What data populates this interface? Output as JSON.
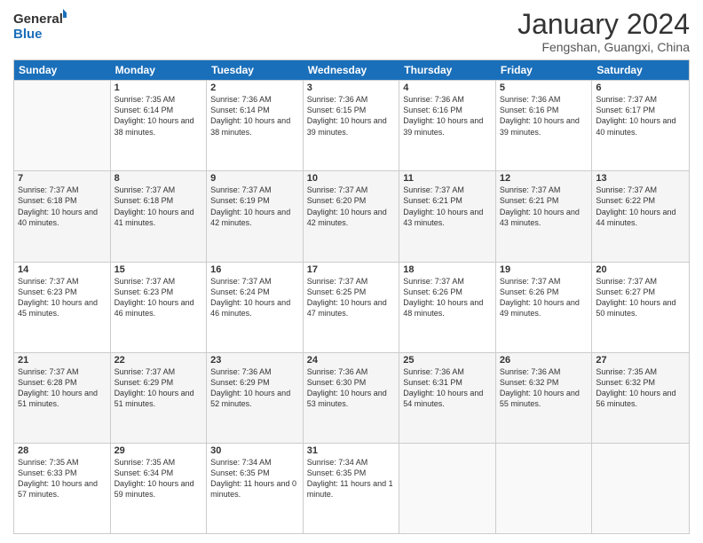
{
  "logo": {
    "line1": "General",
    "line2": "Blue"
  },
  "title": "January 2024",
  "location": "Fengshan, Guangxi, China",
  "weekdays": [
    "Sunday",
    "Monday",
    "Tuesday",
    "Wednesday",
    "Thursday",
    "Friday",
    "Saturday"
  ],
  "weeks": [
    [
      {
        "day": "",
        "empty": true
      },
      {
        "day": "1",
        "sunrise": "7:35 AM",
        "sunset": "6:14 PM",
        "daylight": "10 hours and 38 minutes."
      },
      {
        "day": "2",
        "sunrise": "7:36 AM",
        "sunset": "6:14 PM",
        "daylight": "10 hours and 38 minutes."
      },
      {
        "day": "3",
        "sunrise": "7:36 AM",
        "sunset": "6:15 PM",
        "daylight": "10 hours and 39 minutes."
      },
      {
        "day": "4",
        "sunrise": "7:36 AM",
        "sunset": "6:16 PM",
        "daylight": "10 hours and 39 minutes."
      },
      {
        "day": "5",
        "sunrise": "7:36 AM",
        "sunset": "6:16 PM",
        "daylight": "10 hours and 39 minutes."
      },
      {
        "day": "6",
        "sunrise": "7:37 AM",
        "sunset": "6:17 PM",
        "daylight": "10 hours and 40 minutes."
      }
    ],
    [
      {
        "day": "7",
        "sunrise": "7:37 AM",
        "sunset": "6:18 PM",
        "daylight": "10 hours and 40 minutes."
      },
      {
        "day": "8",
        "sunrise": "7:37 AM",
        "sunset": "6:18 PM",
        "daylight": "10 hours and 41 minutes."
      },
      {
        "day": "9",
        "sunrise": "7:37 AM",
        "sunset": "6:19 PM",
        "daylight": "10 hours and 42 minutes."
      },
      {
        "day": "10",
        "sunrise": "7:37 AM",
        "sunset": "6:20 PM",
        "daylight": "10 hours and 42 minutes."
      },
      {
        "day": "11",
        "sunrise": "7:37 AM",
        "sunset": "6:21 PM",
        "daylight": "10 hours and 43 minutes."
      },
      {
        "day": "12",
        "sunrise": "7:37 AM",
        "sunset": "6:21 PM",
        "daylight": "10 hours and 43 minutes."
      },
      {
        "day": "13",
        "sunrise": "7:37 AM",
        "sunset": "6:22 PM",
        "daylight": "10 hours and 44 minutes."
      }
    ],
    [
      {
        "day": "14",
        "sunrise": "7:37 AM",
        "sunset": "6:23 PM",
        "daylight": "10 hours and 45 minutes."
      },
      {
        "day": "15",
        "sunrise": "7:37 AM",
        "sunset": "6:23 PM",
        "daylight": "10 hours and 46 minutes."
      },
      {
        "day": "16",
        "sunrise": "7:37 AM",
        "sunset": "6:24 PM",
        "daylight": "10 hours and 46 minutes."
      },
      {
        "day": "17",
        "sunrise": "7:37 AM",
        "sunset": "6:25 PM",
        "daylight": "10 hours and 47 minutes."
      },
      {
        "day": "18",
        "sunrise": "7:37 AM",
        "sunset": "6:26 PM",
        "daylight": "10 hours and 48 minutes."
      },
      {
        "day": "19",
        "sunrise": "7:37 AM",
        "sunset": "6:26 PM",
        "daylight": "10 hours and 49 minutes."
      },
      {
        "day": "20",
        "sunrise": "7:37 AM",
        "sunset": "6:27 PM",
        "daylight": "10 hours and 50 minutes."
      }
    ],
    [
      {
        "day": "21",
        "sunrise": "7:37 AM",
        "sunset": "6:28 PM",
        "daylight": "10 hours and 51 minutes."
      },
      {
        "day": "22",
        "sunrise": "7:37 AM",
        "sunset": "6:29 PM",
        "daylight": "10 hours and 51 minutes."
      },
      {
        "day": "23",
        "sunrise": "7:36 AM",
        "sunset": "6:29 PM",
        "daylight": "10 hours and 52 minutes."
      },
      {
        "day": "24",
        "sunrise": "7:36 AM",
        "sunset": "6:30 PM",
        "daylight": "10 hours and 53 minutes."
      },
      {
        "day": "25",
        "sunrise": "7:36 AM",
        "sunset": "6:31 PM",
        "daylight": "10 hours and 54 minutes."
      },
      {
        "day": "26",
        "sunrise": "7:36 AM",
        "sunset": "6:32 PM",
        "daylight": "10 hours and 55 minutes."
      },
      {
        "day": "27",
        "sunrise": "7:35 AM",
        "sunset": "6:32 PM",
        "daylight": "10 hours and 56 minutes."
      }
    ],
    [
      {
        "day": "28",
        "sunrise": "7:35 AM",
        "sunset": "6:33 PM",
        "daylight": "10 hours and 57 minutes."
      },
      {
        "day": "29",
        "sunrise": "7:35 AM",
        "sunset": "6:34 PM",
        "daylight": "10 hours and 59 minutes."
      },
      {
        "day": "30",
        "sunrise": "7:34 AM",
        "sunset": "6:35 PM",
        "daylight": "11 hours and 0 minutes."
      },
      {
        "day": "31",
        "sunrise": "7:34 AM",
        "sunset": "6:35 PM",
        "daylight": "11 hours and 1 minute."
      },
      {
        "day": "",
        "empty": true
      },
      {
        "day": "",
        "empty": true
      },
      {
        "day": "",
        "empty": true
      }
    ]
  ]
}
